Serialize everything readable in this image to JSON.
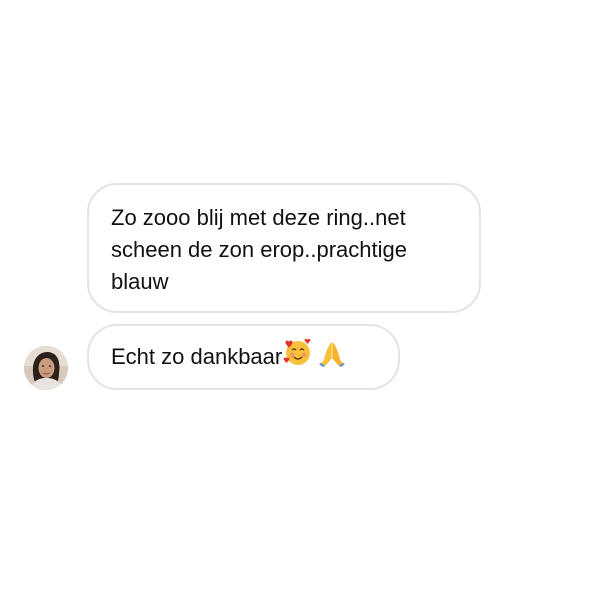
{
  "messages": [
    {
      "text": "Zo zooo blij met deze ring..net scheen de zon erop..prachtige blauw"
    },
    {
      "text": "Echt zo dankbaar",
      "emoji": [
        "smiling-face-with-hearts",
        "folded-hands"
      ]
    }
  ],
  "avatar": {
    "icon": "user-avatar-photo"
  },
  "colors": {
    "background": "#ffffff",
    "bubble_border": "#e3e3e3",
    "text": "#111111"
  }
}
